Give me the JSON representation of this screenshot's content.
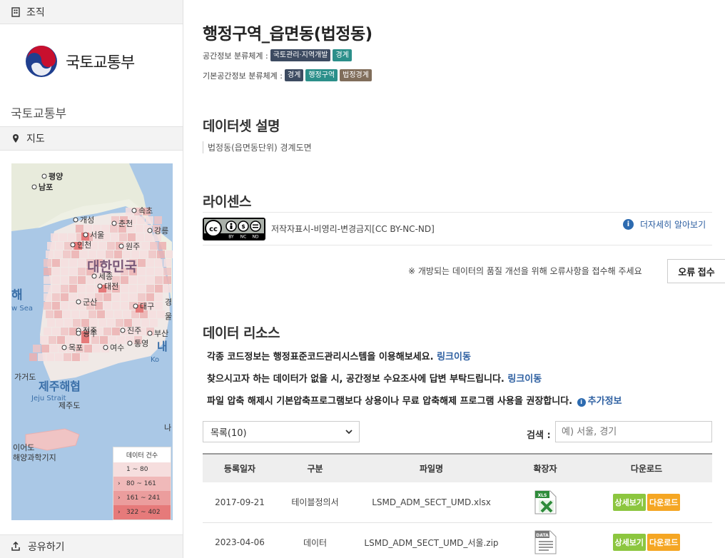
{
  "sidebar": {
    "org_header": "조직",
    "org_logo_text": "국토교통부",
    "org_name": "국토교통부",
    "map_header": "지도",
    "share": "공유하기",
    "map": {
      "labels": [
        "평양",
        "남포",
        "개성",
        "서울",
        "인천",
        "춘천",
        "강릉",
        "속초",
        "원주",
        "대한민국",
        "세종",
        "대전",
        "군산",
        "대구",
        "경",
        "울",
        "전주",
        "광주",
        "진주",
        "부산",
        "목포",
        "여수",
        "통영",
        "해",
        "w Sea",
        "내",
        "Ko",
        "가거도",
        "제주해협",
        "Jeju Strait",
        "제주도",
        "나",
        "이어도",
        "해양과학기지"
      ],
      "legend": {
        "title": "데이터 건수",
        "items": [
          "1 ~ 80",
          "80 ~ 161",
          "161 ~ 241",
          "322 ~ 402"
        ],
        "colors": [
          "#f6dede",
          "#f0b9b9",
          "#eb9d9d",
          "#e67a7a"
        ]
      }
    }
  },
  "main": {
    "title": "행정구역_읍면동(법정동)",
    "spatial_classification": {
      "label": "공간정보 분류체계 :",
      "badges": [
        "국토관리·지역개발",
        "경계"
      ]
    },
    "base_classification": {
      "label": "기본공간정보 분류체계 :",
      "badges": [
        "경계",
        "행정구역",
        "법정경계"
      ]
    },
    "dataset_title": "데이터셋 설명",
    "dataset_desc": "법정동(읍면동단위) 경계도면",
    "license_title": "라이센스",
    "license_text": "저작자표시-비영리-변경금지[CC BY-NC-ND]",
    "cc_badge": [
      "BY",
      "NC",
      "ND"
    ],
    "more_info": "더자세히 알아보기",
    "report_note": "※ 개방되는 데이터의 품질 개선을 위해 오류사항을 접수해 주세요",
    "report_button": "오류 접수",
    "resources_title": "데이터 리소스",
    "guides": [
      {
        "text": "각종 코드정보는 행정표준코드관리시스템을 이용해보세요.",
        "link": "링크이동"
      },
      {
        "text": "찾으시고자 하는 데이터가 없을 시, 공간정보 수요조사에 답변 부탁드립니다.",
        "link": "링크이동"
      },
      {
        "text": "파일 압축 해제시 기본압축프로그램보다 상용이나 무료 압축해제 프로그램 사용을 권장합니다.",
        "link": "추가정보"
      }
    ],
    "list_select": "목록(10)",
    "search_label": "검색 :",
    "search_placeholder": "예) 서울, 경기",
    "table": {
      "headers": [
        "등록일자",
        "구분",
        "파일명",
        "확장자",
        "다운로드"
      ],
      "rows": [
        {
          "date": "2017-09-21",
          "type": "테이블정의서",
          "file": "LSMD_ADM_SECT_UMD.xlsx",
          "ext_icon": "xls-file-icon",
          "ext_label": "XLS"
        },
        {
          "date": "2023-04-06",
          "type": "데이터",
          "file": "LSMD_ADM_SECT_UMD_서울.zip",
          "ext_icon": "data-file-icon",
          "ext_label": "DATA"
        }
      ],
      "detail_btn": "상세보기",
      "download_btn": "다운로드"
    },
    "colors": {
      "link": "#2d5fa1",
      "badge_dark": "#3d4b61",
      "badge_teal": "#2b8f8a",
      "badge_brown": "#806d5a",
      "btn_green": "#8cc63f",
      "btn_orange": "#f5a623"
    }
  }
}
